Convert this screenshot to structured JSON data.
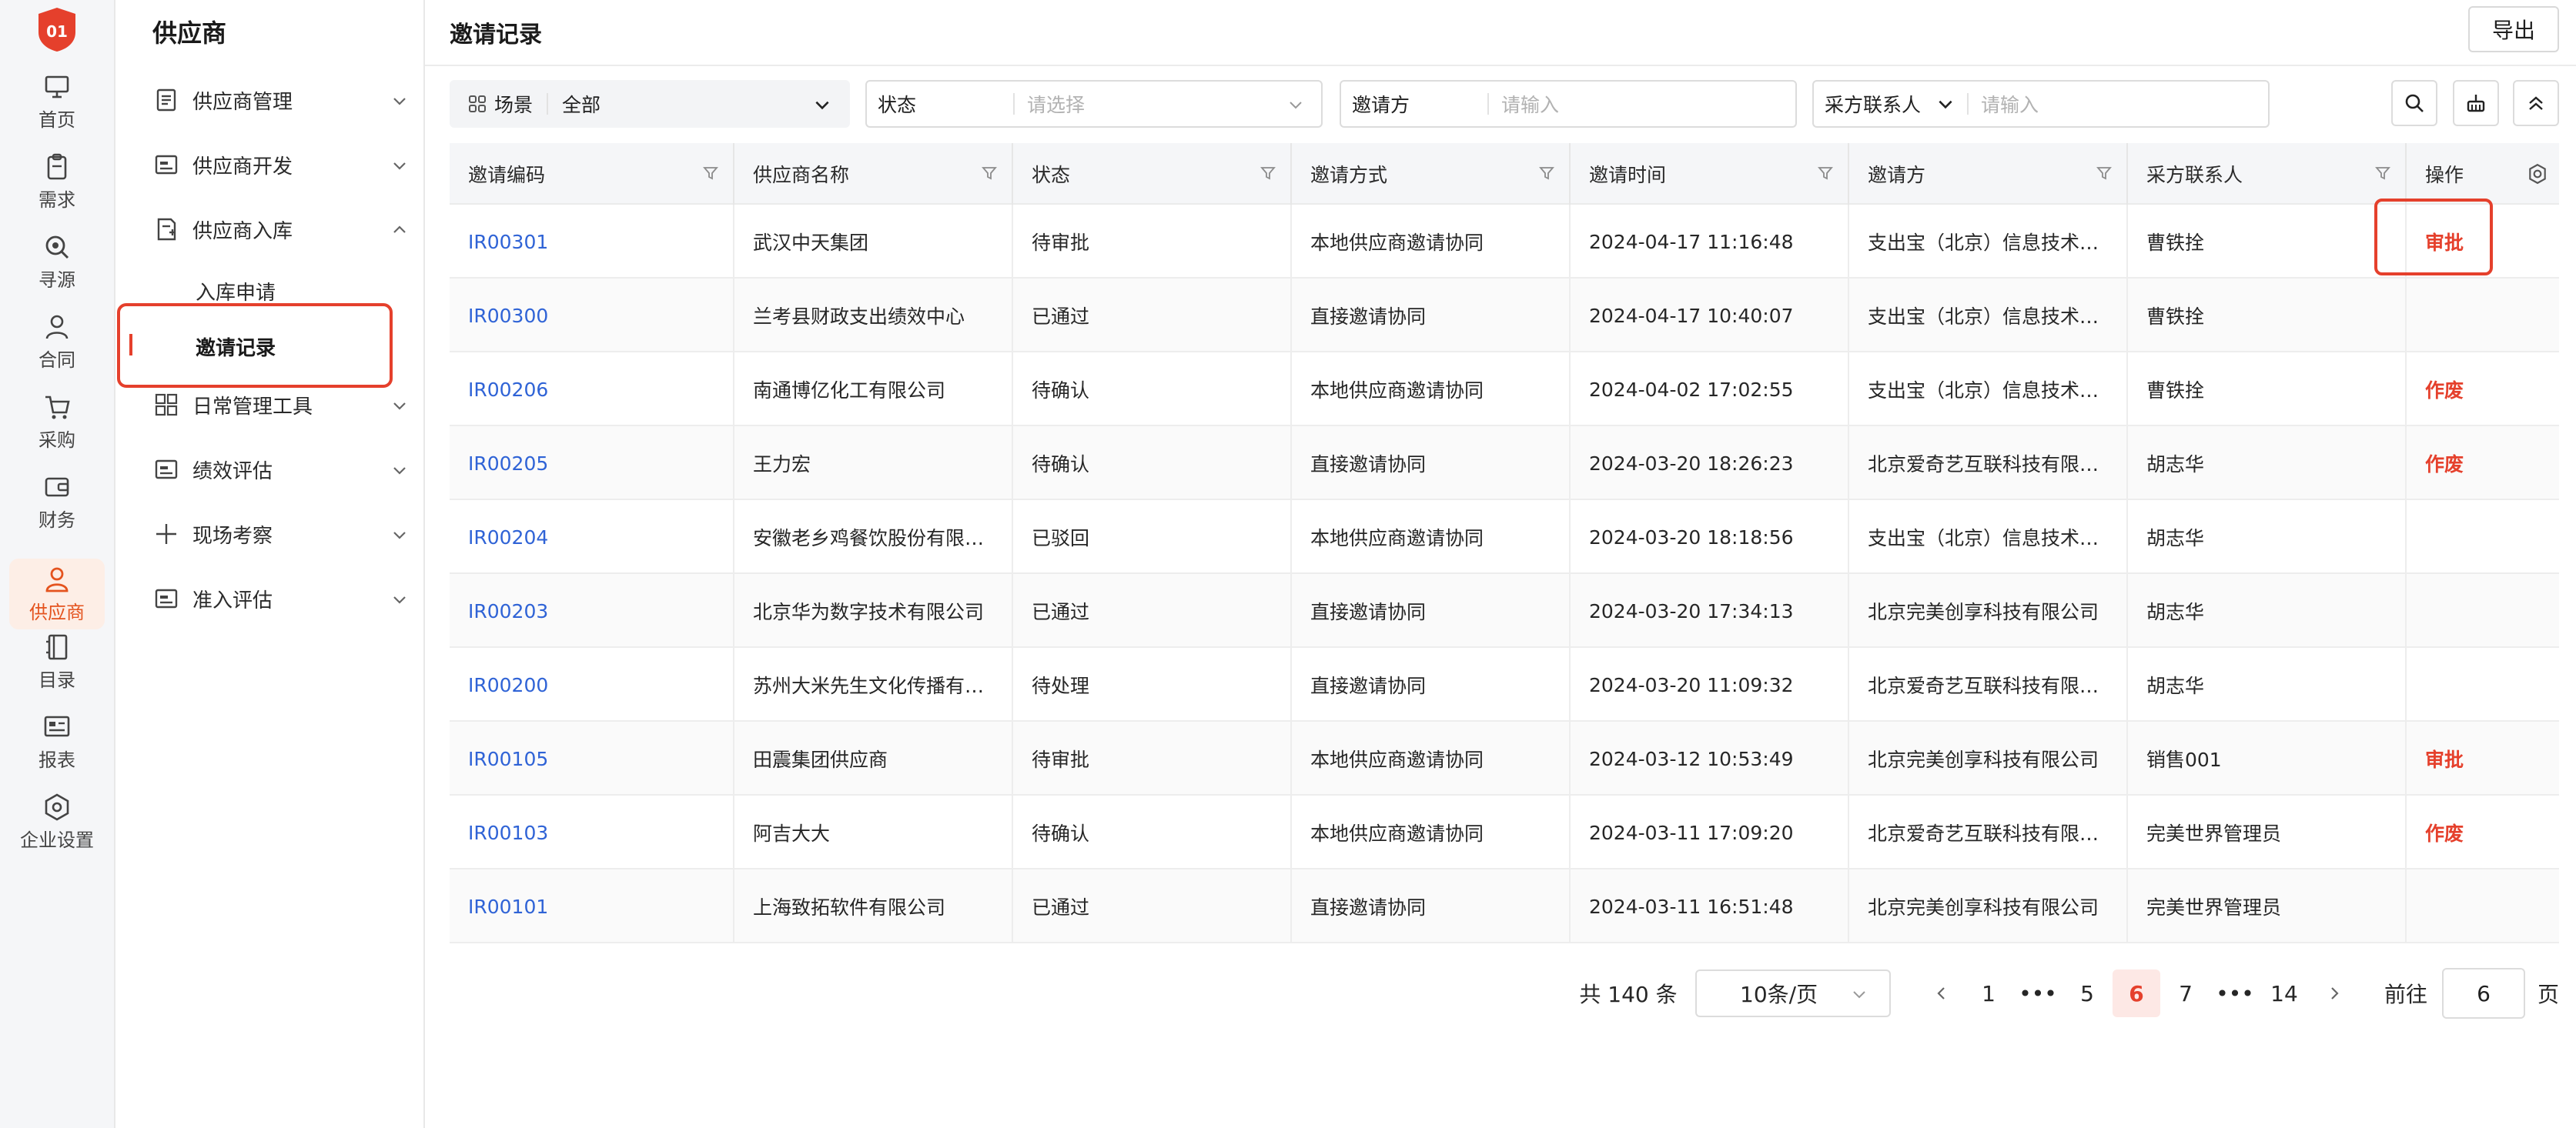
{
  "rail": {
    "items": [
      {
        "label": "首页",
        "icon": "monitor-icon"
      },
      {
        "label": "需求",
        "icon": "clipboard-icon"
      },
      {
        "label": "寻源",
        "icon": "search-source-icon"
      },
      {
        "label": "合同",
        "icon": "person-contract-icon"
      },
      {
        "label": "采购",
        "icon": "cart-icon"
      },
      {
        "label": "财务",
        "icon": "wallet-icon"
      },
      {
        "label": "供应商",
        "icon": "supplier-icon"
      },
      {
        "label": "目录",
        "icon": "catalog-icon"
      },
      {
        "label": "报表",
        "icon": "report-icon"
      },
      {
        "label": "企业设置",
        "icon": "settings-hex-icon"
      }
    ],
    "active_color": "#e4531e"
  },
  "sidebar": {
    "title": "供应商",
    "menu": [
      {
        "label": "供应商管理"
      },
      {
        "label": "供应商开发"
      },
      {
        "label": "供应商入库"
      },
      {
        "label": "日常管理工具"
      },
      {
        "label": "绩效评估"
      },
      {
        "label": "现场考察"
      },
      {
        "label": "准入评估"
      }
    ],
    "sub": [
      {
        "label": "入库申请"
      },
      {
        "label": "邀请记录"
      }
    ]
  },
  "header": {
    "title": "邀请记录",
    "export_label": "导出"
  },
  "filters": {
    "scene_label": "场景",
    "scene_value": "全部",
    "status_label": "状态",
    "status_placeholder": "请选择",
    "inviter_label": "邀请方",
    "inviter_placeholder": "请输入",
    "buyer_label": "采方联系人",
    "buyer_placeholder": "请输入"
  },
  "table": {
    "columns": [
      "邀请编码",
      "供应商名称",
      "状态",
      "邀请方式",
      "邀请时间",
      "邀请方",
      "采方联系人",
      "操作"
    ],
    "rows": [
      {
        "code": "IR00301",
        "supplier": "武汉中天集团",
        "status": "待审批",
        "method": "本地供应商邀请协同",
        "time": "2024-04-17 11:16:48",
        "inviter": "支出宝（北京）信息技术…",
        "contact": "曹铁拴",
        "action": "审批"
      },
      {
        "code": "IR00300",
        "supplier": "兰考县财政支出绩效中心",
        "status": "已通过",
        "method": "直接邀请协同",
        "time": "2024-04-17 10:40:07",
        "inviter": "支出宝（北京）信息技术…",
        "contact": "曹铁拴",
        "action": ""
      },
      {
        "code": "IR00206",
        "supplier": "南通博亿化工有限公司",
        "status": "待确认",
        "method": "本地供应商邀请协同",
        "time": "2024-04-02 17:02:55",
        "inviter": "支出宝（北京）信息技术…",
        "contact": "曹铁拴",
        "action": "作废"
      },
      {
        "code": "IR00205",
        "supplier": "王力宏",
        "status": "待确认",
        "method": "直接邀请协同",
        "time": "2024-03-20 18:26:23",
        "inviter": "北京爱奇艺互联科技有限…",
        "contact": "胡志华",
        "action": "作废"
      },
      {
        "code": "IR00204",
        "supplier": "安徽老乡鸡餐饮股份有限…",
        "status": "已驳回",
        "method": "本地供应商邀请协同",
        "time": "2024-03-20 18:18:56",
        "inviter": "支出宝（北京）信息技术…",
        "contact": "胡志华",
        "action": ""
      },
      {
        "code": "IR00203",
        "supplier": "北京华为数字技术有限公司",
        "status": "已通过",
        "method": "直接邀请协同",
        "time": "2024-03-20 17:34:13",
        "inviter": "北京完美创享科技有限公司",
        "contact": "胡志华",
        "action": ""
      },
      {
        "code": "IR00200",
        "supplier": "苏州大米先生文化传播有…",
        "status": "待处理",
        "method": "直接邀请协同",
        "time": "2024-03-20 11:09:32",
        "inviter": "北京爱奇艺互联科技有限…",
        "contact": "胡志华",
        "action": ""
      },
      {
        "code": "IR00105",
        "supplier": "田震集团供应商",
        "status": "待审批",
        "method": "本地供应商邀请协同",
        "time": "2024-03-12 10:53:49",
        "inviter": "北京完美创享科技有限公司",
        "contact": "销售001",
        "action": "审批"
      },
      {
        "code": "IR00103",
        "supplier": "阿吉大大",
        "status": "待确认",
        "method": "本地供应商邀请协同",
        "time": "2024-03-11 17:09:20",
        "inviter": "北京爱奇艺互联科技有限…",
        "contact": "完美世界管理员",
        "action": "作废"
      },
      {
        "code": "IR00101",
        "supplier": "上海致拓软件有限公司",
        "status": "已通过",
        "method": "直接邀请协同",
        "time": "2024-03-11 16:51:48",
        "inviter": "北京完美创享科技有限公司",
        "contact": "完美世界管理员",
        "action": ""
      }
    ]
  },
  "pagination": {
    "total_text": "共 140 条",
    "page_size": "10条/页",
    "pages": [
      "1",
      "•••",
      "5",
      "6",
      "7",
      "•••",
      "14"
    ],
    "current": "6",
    "goto_prefix": "前往",
    "goto_value": "6",
    "goto_suffix": "页"
  },
  "colors": {
    "accent": "#e5402c",
    "link": "#2f63d6"
  }
}
